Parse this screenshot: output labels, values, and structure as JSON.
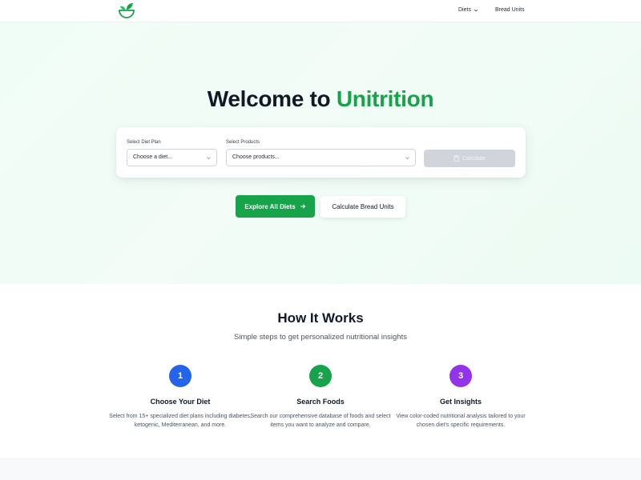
{
  "nav": {
    "diets_label": "Diets",
    "bread_units_label": "Bread Units"
  },
  "hero": {
    "title_prefix": "Welcome to",
    "title_brand": "Unitrition"
  },
  "form": {
    "diet_label": "Select Diet Plan",
    "diet_placeholder": "Choose a diet...",
    "products_label": "Select Products",
    "products_placeholder": "Choose products...",
    "calculate_label": "Calculate"
  },
  "actions": {
    "explore_label": "Explore All Diets",
    "bread_units_label": "Calculate Bread Units"
  },
  "how": {
    "title": "How It Works",
    "subtitle": "Simple steps to get personalized nutritional insights",
    "steps": [
      {
        "number": "1",
        "title": "Choose Your Diet",
        "description": "Select from 15+ specialized diet plans including diabetes, ketogenic, Mediterranean, and more.",
        "color": "#2563eb"
      },
      {
        "number": "2",
        "title": "Search Foods",
        "description": "Search our comprehensive database of foods and select items you want to analyze and compare.",
        "color": "#16a34a"
      },
      {
        "number": "3",
        "title": "Get Insights",
        "description": "View color-coded nutritional analysis tailored to your chosen diet's specific requirements.",
        "color": "#9333ea"
      }
    ]
  },
  "colors": {
    "brand": "#16a34a",
    "disabled": "#d1d5db"
  }
}
